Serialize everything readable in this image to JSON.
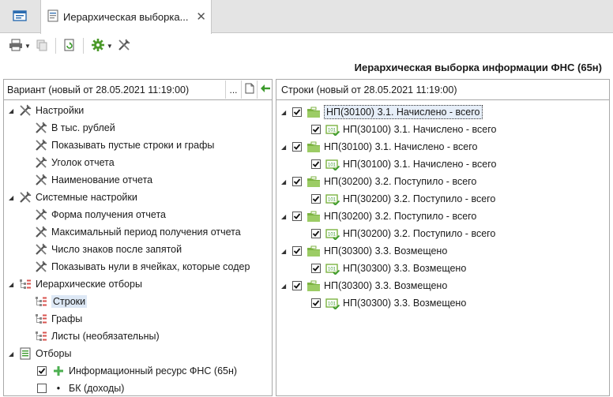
{
  "tab": {
    "title": "Иерархическая выборка...",
    "close": "✕"
  },
  "page": {
    "title": "Иерархическая выборка информации ФНС (65н)"
  },
  "left": {
    "variant": "Вариант (новый от 28.05.2021 11:19:00)",
    "dots": "...",
    "tree": [
      {
        "label": "Настройки",
        "level": 0,
        "icon": "tools-icon",
        "expander": true
      },
      {
        "label": "В тыс. рублей",
        "level": 1,
        "icon": "tools-icon"
      },
      {
        "label": "Показывать пустые строки и графы",
        "level": 1,
        "icon": "tools-icon"
      },
      {
        "label": "Уголок отчета",
        "level": 1,
        "icon": "tools-icon"
      },
      {
        "label": "Наименование отчета",
        "level": 1,
        "icon": "tools-icon"
      },
      {
        "label": "Системные настройки",
        "level": 0,
        "icon": "tools-icon",
        "expander": true
      },
      {
        "label": "Форма получения отчета",
        "level": 1,
        "icon": "tools-icon"
      },
      {
        "label": "Максимальный период получения отчета",
        "level": 1,
        "icon": "tools-icon"
      },
      {
        "label": "Число знаков после запятой",
        "level": 1,
        "icon": "tools-icon"
      },
      {
        "label": "Показывать нули в ячейках, которые содер",
        "level": 1,
        "icon": "tools-icon"
      },
      {
        "label": "Иерархические отборы",
        "level": 0,
        "icon": "hierarchy-icon",
        "expander": true
      },
      {
        "label": "Строки",
        "level": 1,
        "icon": "hierarchy-icon",
        "selected": true
      },
      {
        "label": "Графы",
        "level": 1,
        "icon": "hierarchy-icon"
      },
      {
        "label": "Листы (необязательны)",
        "level": 1,
        "icon": "hierarchy-icon"
      },
      {
        "label": "Отборы",
        "level": 0,
        "icon": "filter-icon",
        "expander": true
      },
      {
        "label": "Информационный ресурс ФНС (65н)",
        "level": 1,
        "checkbox": true,
        "checked": true,
        "icon": "plus-icon"
      },
      {
        "label": "БК (доходы)",
        "level": 1,
        "checkbox": true,
        "checked": false,
        "icon": "bullet-icon",
        "bullet": "•"
      }
    ]
  },
  "right": {
    "title": "Строки (новый от 28.05.2021 11:19:00)",
    "tree": [
      {
        "label": "НП(30100) 3.1. Начислено - всего",
        "level": 0,
        "checked": true,
        "focused": true
      },
      {
        "label": "НП(30100) 3.1. Начислено - всего",
        "level": 1,
        "checked": true
      },
      {
        "label": "НП(30100) 3.1. Начислено - всего",
        "level": 0,
        "checked": true
      },
      {
        "label": "НП(30100) 3.1. Начислено - всего",
        "level": 1,
        "checked": true
      },
      {
        "label": "НП(30200) 3.2. Поступило - всего",
        "level": 0,
        "checked": true
      },
      {
        "label": "НП(30200) 3.2. Поступило - всего",
        "level": 1,
        "checked": true
      },
      {
        "label": "НП(30200) 3.2. Поступило - всего",
        "level": 0,
        "checked": true
      },
      {
        "label": "НП(30200) 3.2. Поступило - всего",
        "level": 1,
        "checked": true
      },
      {
        "label": "НП(30300) 3.3. Возмещено",
        "level": 0,
        "checked": true
      },
      {
        "label": "НП(30300) 3.3. Возмещено",
        "level": 1,
        "checked": true
      },
      {
        "label": "НП(30300) 3.3. Возмещено",
        "level": 0,
        "checked": true
      },
      {
        "label": "НП(30300) 3.3. Возмещено",
        "level": 1,
        "checked": true
      }
    ]
  },
  "colors": {
    "accent": "#3c9a2c",
    "selection": "#dde8f5",
    "folder_green": "#7cb342"
  }
}
